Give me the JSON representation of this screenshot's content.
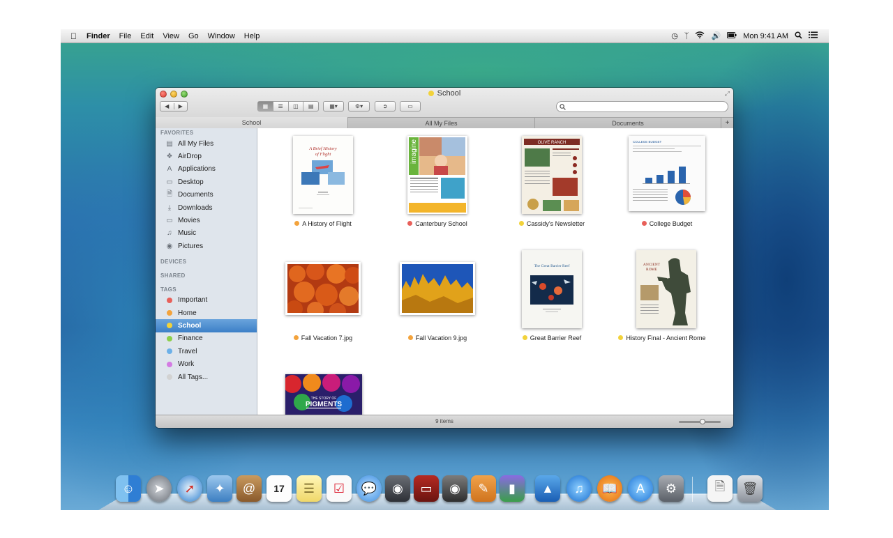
{
  "menubar": {
    "apple": "",
    "app": "Finder",
    "items": [
      "File",
      "Edit",
      "View",
      "Go",
      "Window",
      "Help"
    ],
    "clock": "Mon 9:41 AM",
    "status_icons": [
      "time-machine-icon",
      "bluetooth-icon",
      "wifi-icon",
      "volume-icon",
      "battery-icon"
    ]
  },
  "window": {
    "title": "School",
    "tabs": [
      "School",
      "All My Files",
      "Documents"
    ],
    "tab_add": "+",
    "search_placeholder": "",
    "status": "9 items"
  },
  "sidebar": {
    "favorites_header": "FAVORITES",
    "favorites": [
      {
        "label": "All My Files",
        "icon": "all-files-icon"
      },
      {
        "label": "AirDrop",
        "icon": "airdrop-icon"
      },
      {
        "label": "Applications",
        "icon": "applications-icon"
      },
      {
        "label": "Desktop",
        "icon": "desktop-icon"
      },
      {
        "label": "Documents",
        "icon": "documents-icon"
      },
      {
        "label": "Downloads",
        "icon": "downloads-icon"
      },
      {
        "label": "Movies",
        "icon": "movies-icon"
      },
      {
        "label": "Music",
        "icon": "music-icon"
      },
      {
        "label": "Pictures",
        "icon": "pictures-icon"
      }
    ],
    "devices_header": "DEVICES",
    "shared_header": "SHARED",
    "tags_header": "TAGS",
    "tags": [
      {
        "label": "Important",
        "color": "#e8605a"
      },
      {
        "label": "Home",
        "color": "#f3a33c"
      },
      {
        "label": "School",
        "color": "#f2d23a",
        "selected": true
      },
      {
        "label": "Finance",
        "color": "#8ccf4a"
      },
      {
        "label": "Travel",
        "color": "#6cb0e8"
      },
      {
        "label": "Work",
        "color": "#d47be3"
      },
      {
        "label": "All Tags...",
        "color": "#d2d2d2"
      }
    ]
  },
  "files": [
    {
      "name": "A History of Flight",
      "tags": [
        "#f3a33c",
        "#f2d23a"
      ]
    },
    {
      "name": "Canterbury School",
      "tags": [
        "#e8605a",
        "#f2d23a"
      ]
    },
    {
      "name": "Cassidy's Newsletter",
      "tags": [
        "#f2d23a"
      ]
    },
    {
      "name": "College Budget",
      "tags": [
        "#e8605a",
        "#f2d23a"
      ]
    },
    {
      "name": "Fall Vacation 7.jpg",
      "tags": [
        "#f3a33c",
        "#f2d23a"
      ]
    },
    {
      "name": "Fall Vacation 9.jpg",
      "tags": [
        "#f3a33c",
        "#f2d23a"
      ]
    },
    {
      "name": "Great Barrier Reef",
      "tags": [
        "#f2d23a"
      ]
    },
    {
      "name": "History Final - Ancient Rome",
      "tags": [
        "#f2d23a"
      ]
    },
    {
      "name": "",
      "tags": []
    }
  ],
  "thumb_text": {
    "flight_title": "A Brief History of Flight",
    "imagine": "imagine",
    "newsletter_header": "OLIVE RANCH",
    "budget_header": "COLLEGE BUDGET",
    "reef_title": "The Great Barrier Reef",
    "rome_title": "ANCIENT ROME",
    "pigments_small": "THE STORY OF",
    "pigments_title": "PIGMENTS"
  },
  "dock": {
    "icon_names": [
      "finder-icon",
      "launchpad-icon",
      "safari-icon",
      "mail-icon",
      "contacts-icon",
      "calendar-icon",
      "notes-icon",
      "reminders-icon",
      "messages-icon",
      "facetime-icon",
      "photo-booth-icon",
      "iphoto-icon",
      "pages-icon",
      "numbers-icon",
      "keynote-icon",
      "itunes-icon",
      "ibooks-icon",
      "app-store-icon",
      "system-preferences-icon",
      "document-icon",
      "trash-icon"
    ],
    "calendar_day": "17"
  }
}
